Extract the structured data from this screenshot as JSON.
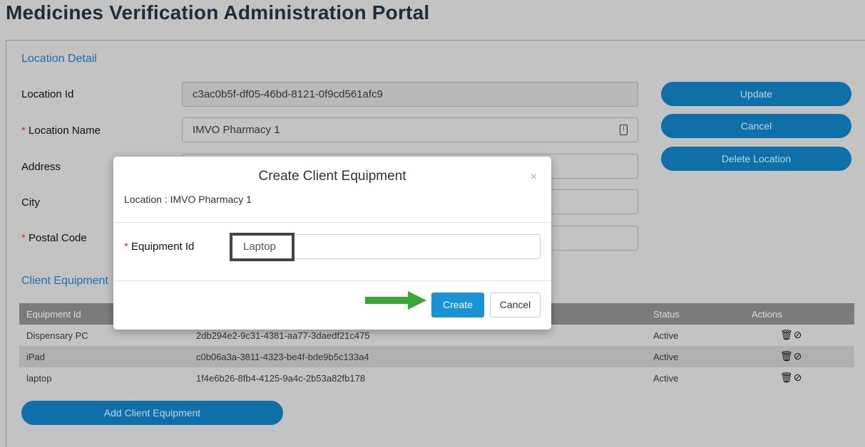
{
  "page_title": "Medicines Verification Administration Portal",
  "location_detail": {
    "heading": "Location Detail",
    "location_id": {
      "label": "Location Id",
      "value": "c3ac0b5f-df05-46bd-8121-0f9cd561afc9"
    },
    "location_name": {
      "required_mark": "*",
      "label": "Location Name",
      "value": "IMVO Pharmacy 1"
    },
    "address": {
      "label": "Address",
      "value": ""
    },
    "city": {
      "label": "City",
      "value": ""
    },
    "postal_code": {
      "required_mark": "*",
      "label": "Postal Code",
      "value": ""
    }
  },
  "actions": {
    "update": "Update",
    "cancel": "Cancel",
    "delete_location": "Delete Location"
  },
  "client_equipment": {
    "heading": "Client Equipment",
    "columns": [
      "Equipment Id",
      "",
      "Status",
      "Actions"
    ],
    "rows": [
      {
        "equipment_id": "Dispensary PC",
        "guid": "2db294e2-9c31-4381-aa77-3daedf21c475",
        "status": "Active"
      },
      {
        "equipment_id": "iPad",
        "guid": "c0b06a3a-3811-4323-be4f-bde9b5c133a4",
        "status": "Active"
      },
      {
        "equipment_id": "laptop",
        "guid": "1f4e6b26-8fb4-4125-9a4c-2b53a82fb178",
        "status": "Active"
      }
    ],
    "add_button": "Add Client Equipment"
  },
  "modal": {
    "title": "Create Client Equipment",
    "close": "×",
    "location_line": "Location : IMVO Pharmacy 1",
    "equipment_id": {
      "required_mark": "*",
      "label": "Equipment Id",
      "value": "Laptop"
    },
    "create": "Create",
    "cancel": "Cancel"
  },
  "icons": {
    "delete": "trash-icon",
    "disable": "ban-icon"
  },
  "colors": {
    "accent": "#0f6fa8",
    "create_button": "#1694d6",
    "arrow": "#3aa835",
    "required": "#c0392b"
  }
}
